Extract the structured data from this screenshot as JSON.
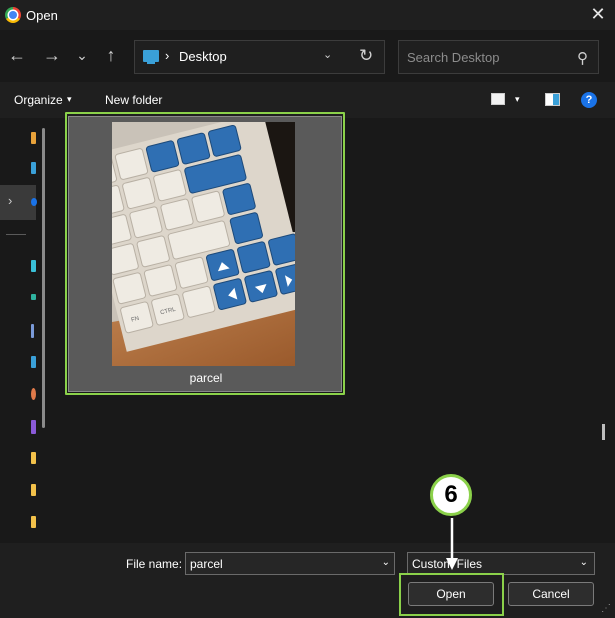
{
  "window": {
    "title": "Open",
    "close_glyph": "✕"
  },
  "navbar": {
    "back_glyph": "←",
    "forward_glyph": "→",
    "recent_glyph": "⌄",
    "up_glyph": "↑",
    "breadcrumb_separator": "›",
    "location": "Desktop",
    "dropdown_glyph": "⌄",
    "refresh_glyph": "↻",
    "search_placeholder": "Search Desktop",
    "search_glyph": "⚲"
  },
  "toolbar": {
    "organize_label": "Organize",
    "organize_caret": "▾",
    "new_folder_label": "New folder",
    "view_caret": "▾",
    "help_glyph": "?"
  },
  "nav_pane": {
    "expand_glyph": "›"
  },
  "files": [
    {
      "name": "parcel",
      "selected": true
    }
  ],
  "bottom": {
    "file_name_label": "File name:",
    "file_name_value": "parcel",
    "file_type_value": "Custom Files",
    "dropdown_glyph": "⌄",
    "open_label": "Open",
    "cancel_label": "Cancel",
    "grip_glyph": "⋰"
  },
  "annotation": {
    "step_number": "6"
  },
  "colors": {
    "highlight": "#8bd14a",
    "accent": "#1a73e8",
    "folder": "#3aa0d8"
  }
}
